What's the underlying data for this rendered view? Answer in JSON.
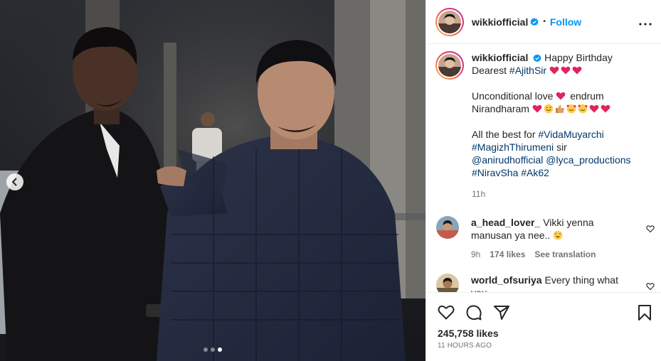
{
  "colors": {
    "link": "#0095f6",
    "hashtag": "#00376b",
    "muted": "#737373",
    "verified": "#0095f6",
    "heart": "#ed4956"
  },
  "post": {
    "username": "wikkiofficial",
    "separator": "•",
    "follow_label": "Follow",
    "more_icon": "more-horizontal-icon",
    "media": {
      "carousel_count": 3,
      "active_index": 3,
      "prev_icon": "chevron-left-icon"
    }
  },
  "caption": {
    "username": "wikkiofficial",
    "line1_text": "Happy Birthday Dearest",
    "line1_tag": "#AjithSir",
    "line2_a": "Unconditional love",
    "line2_b": "endrum",
    "line2_c": "Nirandharam",
    "line3_text": "All the best for",
    "tags": [
      "#VidaMuyarchi",
      "#MagizhThirumeni",
      "sir",
      "@anirudhofficial",
      "@lyca_productions",
      "#NiravSha",
      "#Ak62"
    ],
    "time": "11h"
  },
  "comments": [
    {
      "username": "a_head_lover_",
      "text": "Vikki yenna manusan ya nee..",
      "time": "9h",
      "likes": "174 likes",
      "translate": "See translation"
    },
    {
      "username": "world_ofsuriya",
      "text": "Every thing what you"
    }
  ],
  "footer": {
    "likes": "245,758 likes",
    "ago": "11 HOURS AGO"
  }
}
